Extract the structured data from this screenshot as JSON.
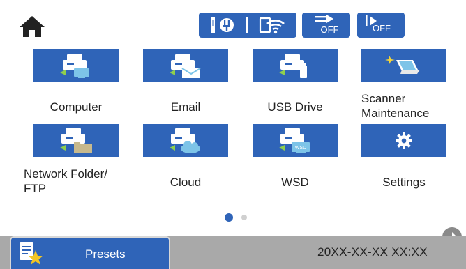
{
  "status_bar": {
    "home_icon": "home-icon",
    "icons": [
      "network-info-icon",
      "wifi-icon",
      "quiet-mode-icon",
      "print-skip-icon"
    ],
    "quiet_mode_label": "OFF",
    "skip_label": "OFF"
  },
  "tiles": [
    {
      "label": "Computer",
      "icon": "computer-scan-icon"
    },
    {
      "label": "Email",
      "icon": "email-scan-icon"
    },
    {
      "label": "USB Drive",
      "icon": "usb-scan-icon"
    },
    {
      "label_line1": "Scanner",
      "label_line2": "Maintenance",
      "icon": "scanner-maintenance-icon"
    },
    {
      "label_line1": "Network Folder/",
      "label_line2": "FTP",
      "icon": "network-folder-icon"
    },
    {
      "label": "Cloud",
      "icon": "cloud-scan-icon"
    },
    {
      "label": "WSD",
      "icon": "wsd-scan-icon"
    },
    {
      "label": "Settings",
      "icon": "gear-icon"
    }
  ],
  "pager": {
    "current_page": 1,
    "total_pages": 2,
    "colors": {
      "active": "#2f64b8",
      "inactive": "#d0d0d0"
    }
  },
  "bottom_bar": {
    "presets_label": "Presets",
    "presets_icon": "presets-star-icon",
    "datetime": "20XX-XX-XX XX:XX"
  },
  "colors": {
    "accent": "#2f64b8",
    "bar": "#a9a9a9"
  }
}
